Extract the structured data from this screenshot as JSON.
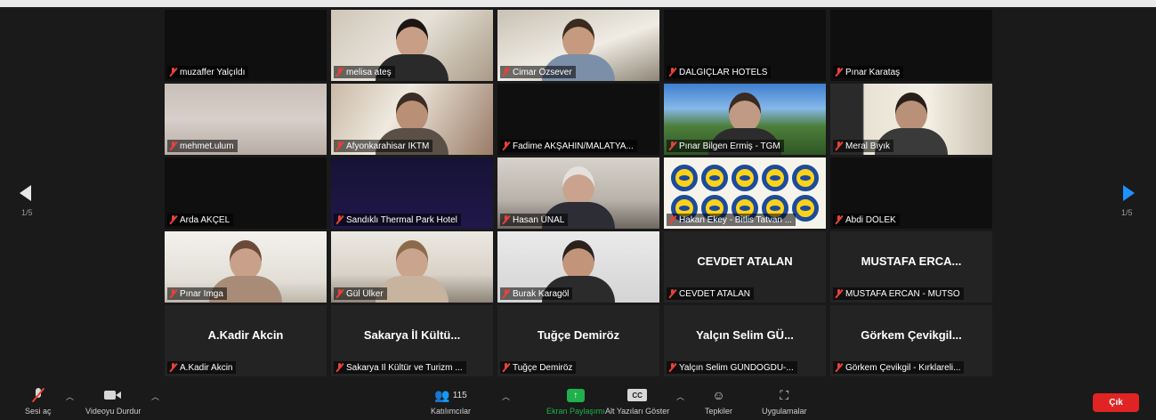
{
  "pagination": {
    "left": "1/5",
    "right": "1/5"
  },
  "tiles": [
    {
      "name": "muzaffer Yalçıldı",
      "kind": "dark"
    },
    {
      "name": "melisa ateş",
      "kind": "video",
      "bg": "office",
      "skin": "#c99e86",
      "hair": "#1d1513",
      "shirt": "#2a2a2a"
    },
    {
      "name": "Cimar Özsever",
      "kind": "video",
      "bg": "room",
      "skin": "#c59a7e",
      "hair": "#3a2a20",
      "shirt": "#7c8fa8"
    },
    {
      "name": "DALGIÇLAR HOTELS",
      "kind": "dark"
    },
    {
      "name": "Pınar Karataş",
      "kind": "dark"
    },
    {
      "name": "mehmet.ulum",
      "kind": "video",
      "bg": "blur"
    },
    {
      "name": "Afyonkarahisar İKTM",
      "kind": "video",
      "bg": "kitchen",
      "skin": "#b98f76",
      "hair": "#3b2c25",
      "shirt": "#5a5048"
    },
    {
      "name": "Fadime AKŞAHİN/MALATYA...",
      "kind": "dark"
    },
    {
      "name": "Pınar Bilgen Ermiş - TGM",
      "kind": "video",
      "bg": "mountain",
      "skin": "#c19a83",
      "hair": "#3b2a22",
      "shirt": "#2c2c2c"
    },
    {
      "name": "Meral Bıyık",
      "kind": "video",
      "bg": "window",
      "skin": "#b99178",
      "hair": "#2a1e19",
      "shirt": "#3a3a3a"
    },
    {
      "name": "Arda AKÇEL",
      "kind": "dark"
    },
    {
      "name": "Sandıklı Thermal Park Hotel",
      "kind": "video",
      "bg": "purple"
    },
    {
      "name": "Hasan ÜNAL",
      "kind": "video",
      "bg": "desk",
      "skin": "#c9a38e",
      "hair": "#e4e1dc",
      "shirt": "#2d2d36"
    },
    {
      "name": "Hakan Ekey - Bitlis Tatvan ...",
      "kind": "logo"
    },
    {
      "name": "Abdi DÖLEK",
      "kind": "dark"
    },
    {
      "name": "Pınar İmga",
      "kind": "video",
      "bg": "wall",
      "skin": "#c9a18a",
      "hair": "#6b4a37",
      "shirt": "#a88c78"
    },
    {
      "name": "Gül Ülker",
      "kind": "video",
      "bg": "shelf",
      "skin": "#caa48c",
      "hair": "#8b6a4c",
      "shirt": "#c7b39e"
    },
    {
      "name": "Burak Karagöl",
      "kind": "video",
      "bg": "white",
      "skin": "#c2957a",
      "hair": "#2a211d",
      "shirt": "#2b2b2b",
      "active": true
    },
    {
      "name": "CEVDET ATALAN",
      "kind": "named",
      "display": "CEVDET ATALAN"
    },
    {
      "name": "MUSTAFA ERCAN - MUTSO",
      "kind": "named",
      "display": "MUSTAFA ERCA..."
    },
    {
      "name": "A.Kadir Akcin",
      "kind": "named",
      "display": "A.Kadir Akcin"
    },
    {
      "name": "Sakarya İl Kültür ve Turizm ...",
      "kind": "named",
      "display": "Sakarya İl Kültü..."
    },
    {
      "name": "Tuğçe Demiröz",
      "kind": "named",
      "display": "Tuğçe Demiröz"
    },
    {
      "name": "Yalçın Selim GÜNDOĞDU-...",
      "kind": "named",
      "display": "Yalçın Selim GÜ..."
    },
    {
      "name": "Görkem Çevikgil - Kırklareli...",
      "kind": "named",
      "display": "Görkem  Çevikgil..."
    }
  ],
  "toolbar": {
    "mute_label": "Sesi aç",
    "video_label": "Videoyu Durdur",
    "participants_label": "Katılımcılar",
    "participants_count": "115",
    "share_label": "Ekran Paylaşımı",
    "captions_label": "Alt Yazıları Göster",
    "captions_icon_text": "CC",
    "reactions_label": "Tepkiler",
    "apps_label": "Uygulamalar",
    "leave_label": "Çık"
  },
  "colors": {
    "active_speaker": "#b5d64a",
    "share_green": "#1fb14b",
    "leave_red": "#e02424",
    "next_arrow": "#1e90ff",
    "muted_red": "#e8423a"
  }
}
